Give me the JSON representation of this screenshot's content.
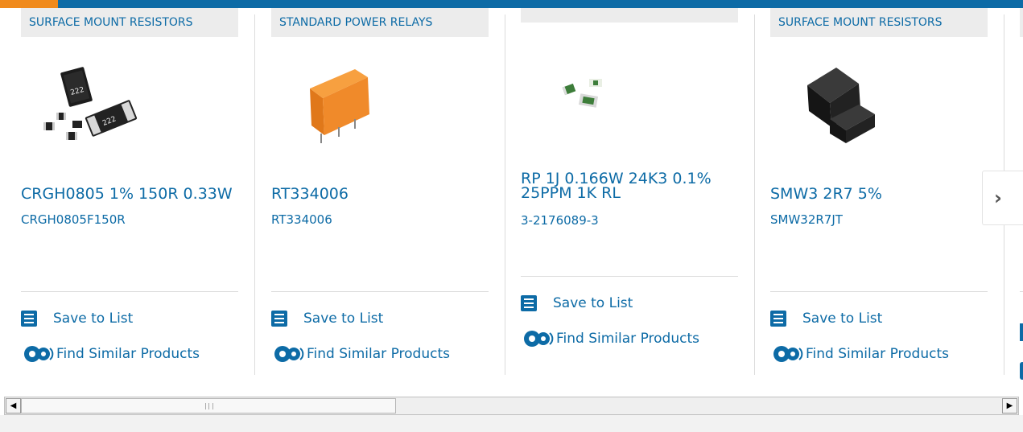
{
  "carousel": {
    "cards": [
      {
        "category": "SURFACE MOUNT RESISTORS",
        "title": "CRGH0805 1% 150R 0.33W",
        "part_number": "CRGH0805F150R",
        "image_icon": "smd-resistors-image",
        "save_label": "Save to List",
        "similar_label": "Find Similar Products"
      },
      {
        "category": "STANDARD POWER RELAYS",
        "title": "RT334006",
        "part_number": "RT334006",
        "image_icon": "power-relay-image",
        "save_label": "Save to List",
        "similar_label": "Find Similar Products"
      },
      {
        "category": "",
        "title": "RP 1J 0.166W 24K3 0.1% 25PPM 1K RL",
        "part_number": "3-2176089-3",
        "image_icon": "chip-resistors-image",
        "save_label": "Save to List",
        "similar_label": "Find Similar Products"
      },
      {
        "category": "SURFACE MOUNT RESISTORS",
        "title": "SMW3 2R7 5%",
        "part_number": "SMW32R7JT",
        "image_icon": "wirewound-resistor-image",
        "save_label": "Save to List",
        "similar_label": "Find Similar Products"
      }
    ],
    "next_icon": "chevron-right-icon",
    "next_label": "›"
  },
  "scrollbar": {
    "left_arrow": "◀",
    "right_arrow": "▶"
  },
  "colors": {
    "brand_blue": "#0d6ba6",
    "accent_orange": "#f08a1c",
    "tag_bg": "#ececec"
  }
}
